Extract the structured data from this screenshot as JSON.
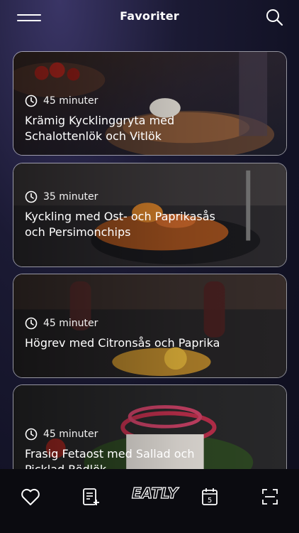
{
  "header": {
    "title": "Favoriter"
  },
  "recipes": [
    {
      "time": "45 minuter",
      "name": "Krämig Kycklinggryta med Schalottenlök och Vitlök"
    },
    {
      "time": "35 minuter",
      "name": "Kyckling med Ost- och Paprikasås och Persimonchips"
    },
    {
      "time": "45 minuter",
      "name": "Högrev med Citronsås och Paprika"
    },
    {
      "time": "45 minuter",
      "name": "Frasig Fetaost med Sallad och Picklad Rödlök"
    }
  ],
  "tabbar": {
    "logo_text": "EATLY",
    "calendar_day": "5"
  }
}
